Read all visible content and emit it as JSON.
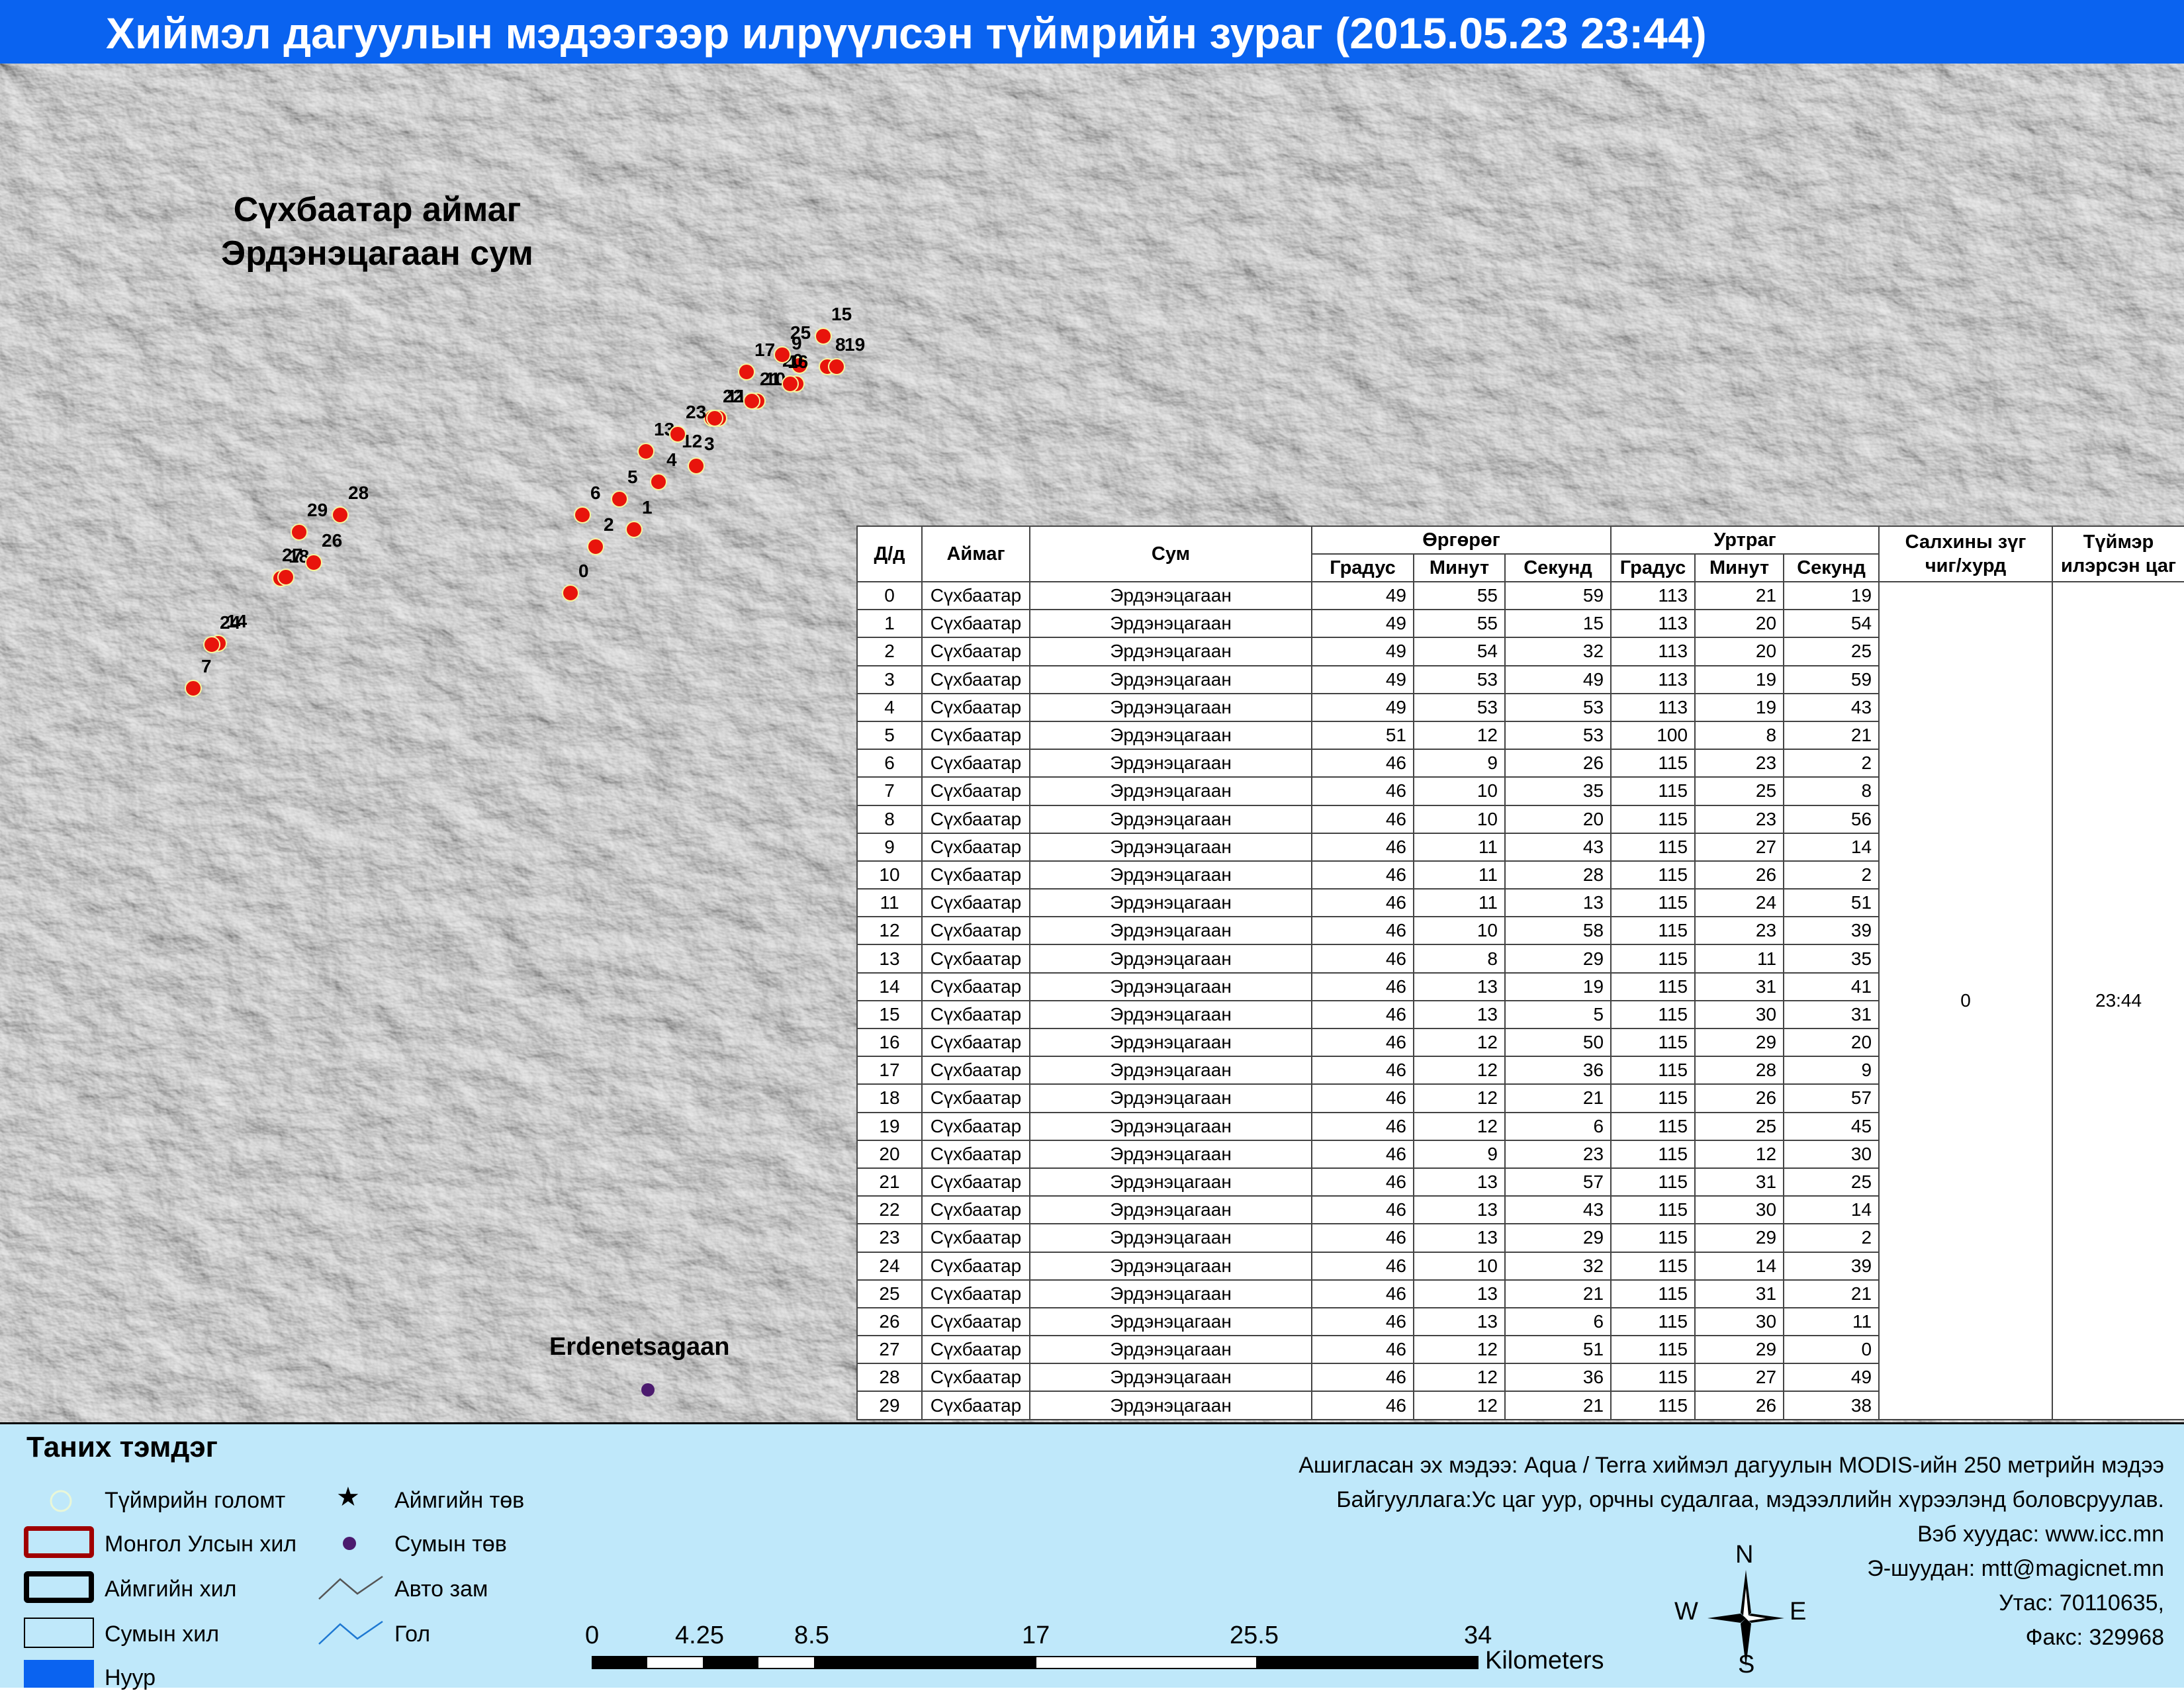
{
  "title": "Хиймэл дагуулын мэдээгээр илрүүлсэн түймрийн зураг  (2015.05.23 23:44)",
  "map": {
    "region_line1": "Сүхбаатар аймаг",
    "region_line2": "Эрдэнэцагаан сум",
    "town": "Erdenetsagaan",
    "fire_labels": [
      "0",
      "1",
      "2",
      "3",
      "4",
      "5",
      "6",
      "7",
      "8",
      "9",
      "10",
      "11",
      "12",
      "13",
      "14",
      "15",
      "16",
      "17",
      "18",
      "19",
      "20",
      "21",
      "22",
      "23",
      "24",
      "25",
      "26",
      "27",
      "28",
      "29"
    ]
  },
  "table": {
    "headers": {
      "id": "Д/д",
      "aimag": "Аймаг",
      "sum": "Сум",
      "lat": "Өргөрөг",
      "lon": "Уртраг",
      "deg": "Градус",
      "min": "Минут",
      "sec": "Секунд",
      "wind_line1": "Салхины зүг",
      "wind_line2": "чиг/хурд",
      "time_line1": "Түймэр",
      "time_line2": "илэрсэн цаг"
    },
    "wind_value": "0",
    "time_value": "23:44",
    "rows": [
      [
        "0",
        "Сүхбаатар",
        "Эрдэнэцагаан",
        "49",
        "55",
        "59",
        "113",
        "21",
        "19"
      ],
      [
        "1",
        "Сүхбаатар",
        "Эрдэнэцагаан",
        "49",
        "55",
        "15",
        "113",
        "20",
        "54"
      ],
      [
        "2",
        "Сүхбаатар",
        "Эрдэнэцагаан",
        "49",
        "54",
        "32",
        "113",
        "20",
        "25"
      ],
      [
        "3",
        "Сүхбаатар",
        "Эрдэнэцагаан",
        "49",
        "53",
        "49",
        "113",
        "19",
        "59"
      ],
      [
        "4",
        "Сүхбаатар",
        "Эрдэнэцагаан",
        "49",
        "53",
        "53",
        "113",
        "19",
        "43"
      ],
      [
        "5",
        "Сүхбаатар",
        "Эрдэнэцагаан",
        "51",
        "12",
        "53",
        "100",
        "8",
        "21"
      ],
      [
        "6",
        "Сүхбаатар",
        "Эрдэнэцагаан",
        "46",
        "9",
        "26",
        "115",
        "23",
        "2"
      ],
      [
        "7",
        "Сүхбаатар",
        "Эрдэнэцагаан",
        "46",
        "10",
        "35",
        "115",
        "25",
        "8"
      ],
      [
        "8",
        "Сүхбаатар",
        "Эрдэнэцагаан",
        "46",
        "10",
        "20",
        "115",
        "23",
        "56"
      ],
      [
        "9",
        "Сүхбаатар",
        "Эрдэнэцагаан",
        "46",
        "11",
        "43",
        "115",
        "27",
        "14"
      ],
      [
        "10",
        "Сүхбаатар",
        "Эрдэнэцагаан",
        "46",
        "11",
        "28",
        "115",
        "26",
        "2"
      ],
      [
        "11",
        "Сүхбаатар",
        "Эрдэнэцагаан",
        "46",
        "11",
        "13",
        "115",
        "24",
        "51"
      ],
      [
        "12",
        "Сүхбаатар",
        "Эрдэнэцагаан",
        "46",
        "10",
        "58",
        "115",
        "23",
        "39"
      ],
      [
        "13",
        "Сүхбаатар",
        "Эрдэнэцагаан",
        "46",
        "8",
        "29",
        "115",
        "11",
        "35"
      ],
      [
        "14",
        "Сүхбаатар",
        "Эрдэнэцагаан",
        "46",
        "13",
        "19",
        "115",
        "31",
        "41"
      ],
      [
        "15",
        "Сүхбаатар",
        "Эрдэнэцагаан",
        "46",
        "13",
        "5",
        "115",
        "30",
        "31"
      ],
      [
        "16",
        "Сүхбаатар",
        "Эрдэнэцагаан",
        "46",
        "12",
        "50",
        "115",
        "29",
        "20"
      ],
      [
        "17",
        "Сүхбаатар",
        "Эрдэнэцагаан",
        "46",
        "12",
        "36",
        "115",
        "28",
        "9"
      ],
      [
        "18",
        "Сүхбаатар",
        "Эрдэнэцагаан",
        "46",
        "12",
        "21",
        "115",
        "26",
        "57"
      ],
      [
        "19",
        "Сүхбаатар",
        "Эрдэнэцагаан",
        "46",
        "12",
        "6",
        "115",
        "25",
        "45"
      ],
      [
        "20",
        "Сүхбаатар",
        "Эрдэнэцагаан",
        "46",
        "9",
        "23",
        "115",
        "12",
        "30"
      ],
      [
        "21",
        "Сүхбаатар",
        "Эрдэнэцагаан",
        "46",
        "13",
        "57",
        "115",
        "31",
        "25"
      ],
      [
        "22",
        "Сүхбаатар",
        "Эрдэнэцагаан",
        "46",
        "13",
        "43",
        "115",
        "30",
        "14"
      ],
      [
        "23",
        "Сүхбаатар",
        "Эрдэнэцагаан",
        "46",
        "13",
        "29",
        "115",
        "29",
        "2"
      ],
      [
        "24",
        "Сүхбаатар",
        "Эрдэнэцагаан",
        "46",
        "10",
        "32",
        "115",
        "14",
        "39"
      ],
      [
        "25",
        "Сүхбаатар",
        "Эрдэнэцагаан",
        "46",
        "13",
        "21",
        "115",
        "31",
        "21"
      ],
      [
        "26",
        "Сүхбаатар",
        "Эрдэнэцагаан",
        "46",
        "13",
        "6",
        "115",
        "30",
        "11"
      ],
      [
        "27",
        "Сүхбаатар",
        "Эрдэнэцагаан",
        "46",
        "12",
        "51",
        "115",
        "29",
        "0"
      ],
      [
        "28",
        "Сүхбаатар",
        "Эрдэнэцагаан",
        "46",
        "12",
        "36",
        "115",
        "27",
        "49"
      ],
      [
        "29",
        "Сүхбаатар",
        "Эрдэнэцагаан",
        "46",
        "12",
        "21",
        "115",
        "26",
        "38"
      ]
    ]
  },
  "legend": {
    "title": "Таних тэмдэг",
    "fire": "Түймрийн голомт",
    "border_country": "Монгол Улсын хил",
    "border_aimag": "Аймгийн хил",
    "border_sum": "Сумын хил",
    "lake": "Нуур",
    "aimag_center": "Аймгийн төв",
    "sum_center": "Сумын төв",
    "road": "Авто зам",
    "river": "Гол"
  },
  "credits": [
    "Ашигласан эх мэдээ: Aqua / Terra хиймэл дагуулын MODIS-ийн 250 метрийн мэдээ",
    "Байгууллага:Ус цаг уур, орчны судалгаа, мэдээллийн хүрээлэнд боловсруулав.",
    "Вэб хуудас: www.icc.mn",
    "Э-шуудан: mtt@magicnet.mn",
    "Утас: 70110635,",
    "Факс: 329968"
  ],
  "scale": {
    "ticks": [
      "0",
      "4.25",
      "8.5",
      "17",
      "25.5",
      "34"
    ],
    "unit": "Kilometers"
  },
  "compass": {
    "n": "N",
    "s": "S",
    "e": "E",
    "w": "W"
  },
  "colors": {
    "title_bg": "#0A63F0",
    "legend_bg": "#BFE8FA",
    "fire": "#E8140C",
    "lake": "#0A63F0",
    "country_border": "#A00000",
    "road": "#555555",
    "river": "#1E78D2"
  }
}
